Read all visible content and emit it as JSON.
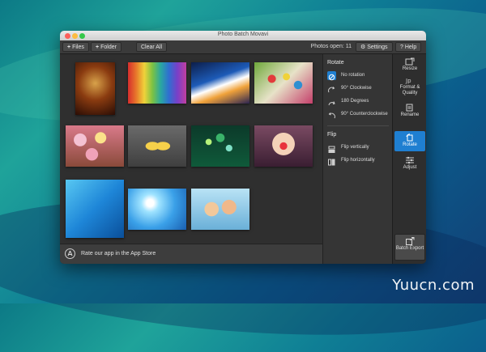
{
  "desktop": {
    "watermark": "Yuucn.com"
  },
  "window": {
    "title": "Photo Batch Movavi"
  },
  "toolbar": {
    "files_label": "Files",
    "folder_label": "Folder",
    "clear_all_label": "Clear All",
    "photos_open": "Photos open: 11",
    "settings_label": "Settings",
    "help_label": "Help"
  },
  "footer": {
    "rate_label": "Rate our app in the App Store"
  },
  "rotate_panel": {
    "rotate_title": "Rotate",
    "options": [
      "No rotation",
      "90° Clockwise",
      "180 Degrees",
      "90° Counterclockwise"
    ],
    "selected": "No rotation",
    "flip_title": "Flip",
    "flip_options": [
      "Flip vertically",
      "Flip horizontally"
    ]
  },
  "sidebar": {
    "items": [
      "Resize",
      "Format & Quality",
      "Rename",
      "Rotate",
      "Adjust"
    ],
    "active": "Rotate",
    "batch_export": "Batch Export"
  },
  "photos": [
    {
      "name": "photo-dancer"
    },
    {
      "name": "photo-rainbow-wood"
    },
    {
      "name": "photo-light-trails"
    },
    {
      "name": "photo-paint-palette"
    },
    {
      "name": "photo-cupcakes"
    },
    {
      "name": "photo-flip-flops"
    },
    {
      "name": "photo-green-bokeh"
    },
    {
      "name": "photo-heart-hands"
    },
    {
      "name": "photo-water"
    },
    {
      "name": "photo-sunburst"
    },
    {
      "name": "photo-couple"
    }
  ],
  "colors": {
    "accent": "#1f7fd1",
    "window_bg": "#2b2b2b"
  }
}
